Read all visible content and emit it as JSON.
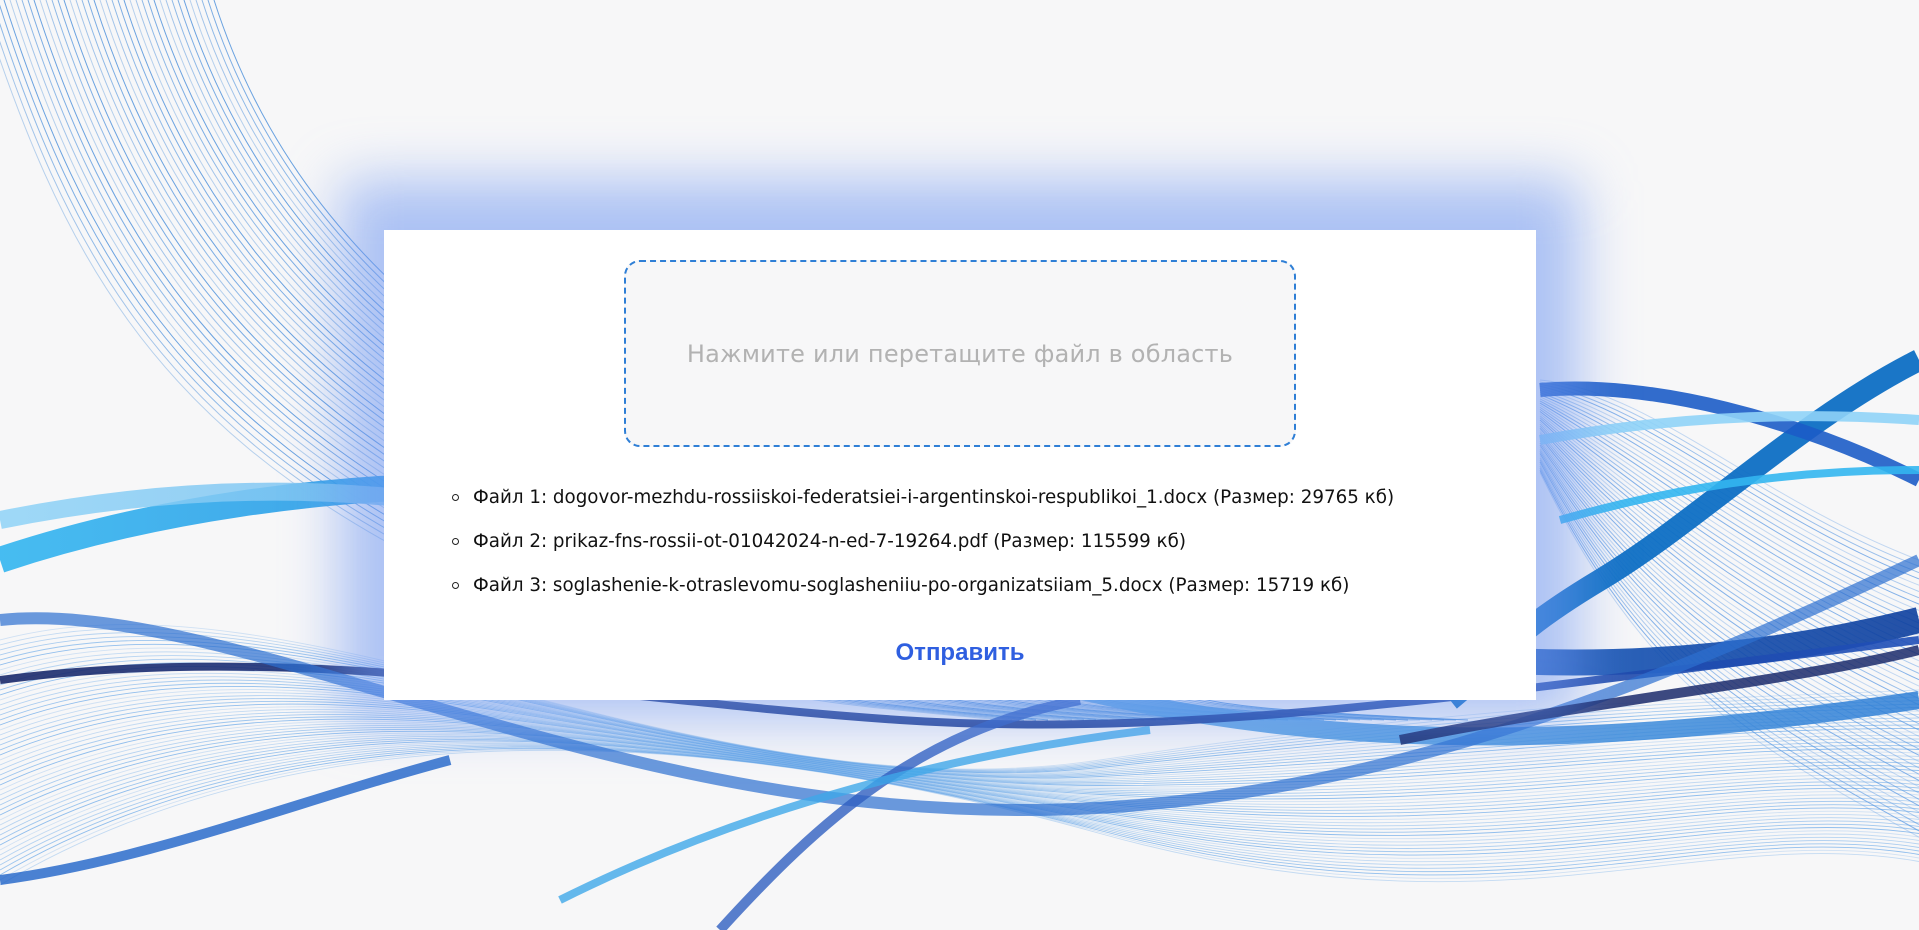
{
  "dropzone": {
    "text": "Нажмите или перетащите файл в область"
  },
  "files": [
    {
      "text": "Файл 1: dogovor-mezhdu-rossiiskoi-federatsiei-i-argentinskoi-respublikoi_1.docx (Размер: 29765 кб)"
    },
    {
      "text": "Файл 2: prikaz-fns-rossii-ot-01042024-n-ed-7-19264.pdf (Размер: 115599 кб)"
    },
    {
      "text": "Файл 3: soglashenie-k-otraslevomu-soglasheniiu-po-organizatsiiam_5.docx (Размер: 15719 кб)"
    }
  ],
  "submit": {
    "label": "Отправить"
  },
  "colors": {
    "accent": "#2f5fe0",
    "dropzone_border": "#2f7fd6",
    "background": "#f7f7f8"
  }
}
